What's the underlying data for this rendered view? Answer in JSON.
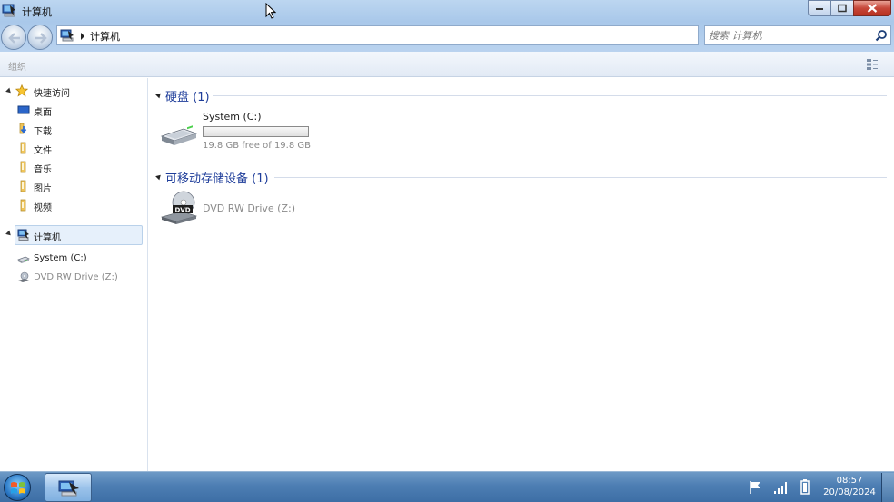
{
  "window": {
    "title": "计算机",
    "buttons": {
      "minimize": "minimize-icon",
      "maximize": "maximize-icon",
      "close": "close-icon"
    }
  },
  "navbar": {
    "address": {
      "icon": "computer-icon",
      "crumb": "计算机"
    },
    "search": {
      "placeholder": "搜索 计算机",
      "icon": "search-icon"
    }
  },
  "toolbar": {
    "organize": "组织",
    "view_icon": "change-view-icon"
  },
  "sidebar": {
    "quick_access": {
      "label": "快速访问",
      "icon": "star-icon",
      "items": [
        {
          "label": "桌面",
          "icon": "desktop-icon"
        },
        {
          "label": "下载",
          "icon": "downloads-icon"
        },
        {
          "label": "文件",
          "icon": "folder-icon"
        },
        {
          "label": "音乐",
          "icon": "folder-icon"
        },
        {
          "label": "图片",
          "icon": "folder-icon"
        },
        {
          "label": "视频",
          "icon": "folder-icon"
        }
      ]
    },
    "computer": {
      "label": "计算机",
      "icon": "computer-icon",
      "items": [
        {
          "label": "System (C:)",
          "icon": "hard-drive-icon"
        },
        {
          "label": "DVD RW Drive (Z:)",
          "icon": "dvd-drive-icon"
        }
      ]
    }
  },
  "content": {
    "groups": [
      {
        "title": "硬盘 (1)",
        "items": [
          {
            "name": "System (C:)",
            "free_text": "19.8 GB free of 19.8 GB",
            "used_fraction": 0.0,
            "icon": "hard-drive-icon"
          }
        ]
      },
      {
        "title": "可移动存储设备 (1)",
        "items": [
          {
            "name": "DVD RW Drive (Z:)",
            "icon": "dvd-drive-icon",
            "dvd_label": "DVD"
          }
        ]
      }
    ]
  },
  "taskbar": {
    "start_icon": "windows-logo-icon",
    "apps": [
      {
        "name": "Windows Explorer",
        "icon": "explorer-icon"
      }
    ],
    "tray_icons": [
      "action-center-flag-icon",
      "network-signal-icon",
      "battery-icon"
    ],
    "time": "08:57",
    "date": "20/08/2024"
  },
  "colors": {
    "accent": "#1e3d9a",
    "titlebar": "#bcd6f0",
    "taskbar": "#4d7eb3",
    "selection": "#e6f0fb"
  }
}
